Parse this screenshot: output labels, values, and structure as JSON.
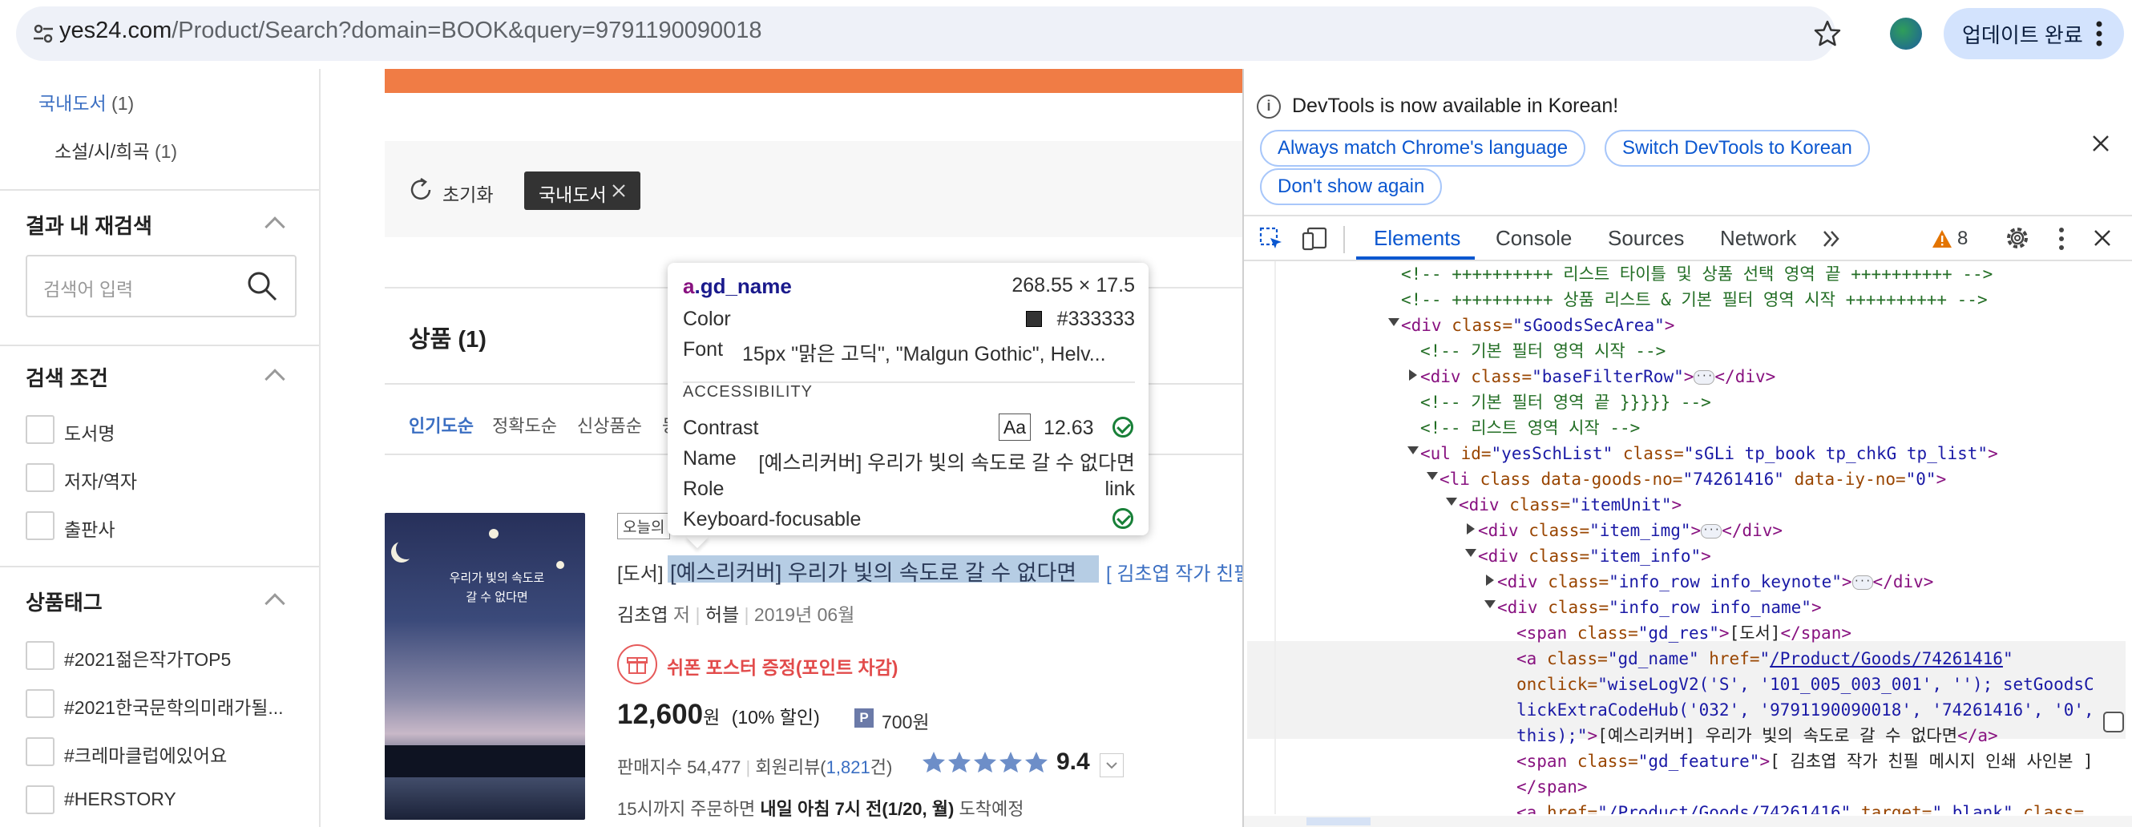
{
  "browser": {
    "url_host": "yes24.com",
    "url_path": "/Product/Search?domain=BOOK&query=9791190090018",
    "update_button": "업데이트 완료"
  },
  "sidebar": {
    "category": {
      "label": "국내도서",
      "count": "(1)"
    },
    "subcategory": {
      "label": "소설/시/희곡",
      "count": "(1)"
    },
    "research_title": "결과 내 재검색",
    "research_placeholder": "검색어 입력",
    "conditions_title": "검색 조건",
    "conditions": [
      "도서명",
      "저자/역자",
      "출판사"
    ],
    "tags_title": "상품태그",
    "tags": [
      "#2021젊은작가TOP5",
      "#2021한국문학의미래가될...",
      "#크레마클럽에있어요",
      "#HERSTORY"
    ]
  },
  "filter": {
    "reset_label": "초기화",
    "chip_label": "국내도서"
  },
  "results": {
    "title": "상품 (1)",
    "sort": [
      "인기도순",
      "정확도순",
      "신상품순",
      "등"
    ],
    "badge": "오늘의",
    "product": {
      "category": "[도서]",
      "title": "[예스리커버] 우리가 빛의 속도로 갈 수 없다면",
      "feature": "[ 김초엽 작가 친필",
      "author": "김초엽",
      "author_role": "저",
      "publisher": "허블",
      "date": "2019년 06월",
      "gift": "쉬폰 포스터 증정(포인트 차감)",
      "price": "12,600",
      "price_unit": "원",
      "discount": "(10% 할인)",
      "points": "700원",
      "sales_index": "판매지수 54,477",
      "review_label": "회원리뷰(",
      "review_count": "1,821",
      "review_suffix": "건)",
      "rating": "9.4",
      "stars": 5,
      "delivery_prefix": "15시까지 주문하면",
      "delivery_bold": "내일 아침 7시 전(1/20, 월)",
      "delivery_suffix": "도착예정",
      "cover_text": "우리가 빛의 속도로 갈 수 없다면"
    }
  },
  "tooltip": {
    "selector_tag": "a",
    "selector_class": ".gd_name",
    "size": "268.55 × 17.5",
    "color_label": "Color",
    "color_value": "#333333",
    "font_label": "Font",
    "font_value": "15px \"맑은 고딕\", \"Malgun Gothic\", Helv...",
    "accessibility_title": "ACCESSIBILITY",
    "contrast_label": "Contrast",
    "contrast_aa": "Aa",
    "contrast_value": "12.63",
    "name_label": "Name",
    "name_value": "[예스리커버] 우리가 빛의 속도로 갈 수 없다면",
    "role_label": "Role",
    "role_value": "link",
    "keyboard_label": "Keyboard-focusable"
  },
  "devtools": {
    "info_text": "DevTools is now available in Korean!",
    "btn_match": "Always match Chrome's language",
    "btn_switch": "Switch DevTools to Korean",
    "btn_dont": "Don't show again",
    "tabs": [
      "Elements",
      "Console",
      "Sources",
      "Network"
    ],
    "warning_count": "8"
  },
  "code": {
    "l1": "<!-- ++++++++++ 리스트 타이틀 및 상품 선택 영역 끝 ++++++++++ -->",
    "l2": "<!-- ++++++++++ 상품 리스트 & 기본 필터 영역 시작 ++++++++++ -->",
    "l3a": "<div",
    "l3b": "class=",
    "l3c": "\"sGoodsSecArea\"",
    "l4": "<!--  기본 필터 영역 시작  -->",
    "l5c": "\"baseFilterRow\"",
    "l6": "<!--  기본 필터 영역 끝 }}}}} -->",
    "l7": "<!--  리스트 영역 시작  -->",
    "l8a": "<ul",
    "l8b": "id=",
    "l8c": "\"yesSchList\"",
    "l8d": "\"sGLi tp_book tp_chkG tp_list\"",
    "l9a": "<li",
    "l9b": "class data-goods-no=",
    "l9c": "\"74261416\"",
    "l9d": "data-iy-no=",
    "l9e": "\"0\"",
    "l10c": "\"itemUnit\"",
    "l11c": "\"item_img\"",
    "l12c": "\"item_info\"",
    "l13c": "\"info_row info_keynote\"",
    "l14c": "\"info_row info_name\"",
    "l15a": "<span",
    "l15c": "\"gd_res\"",
    "l15t": "[도서]",
    "l16a": "<a",
    "l16c": "\"gd_name\"",
    "l16h": "href=",
    "l16l": "/Product/Goods/74261416",
    "l17a": "onclick=",
    "l17b": "\"wiseLogV2('S', '101_005_003_001', ''); setGoodsC",
    "l18": "lickExtraCodeHub('032', '9791190090018', '74261416', '0',",
    "l19a": "this);\"",
    "l19t": "[예스리커버] 우리가 빛의 속도로 갈 수 없다면",
    "l20c": "\"gd_feature\"",
    "l20t": "[ 김초엽 작가 친필 메시지 인쇄 사인본 ]",
    "l21": "</span>",
    "l22l": "/Product/Goods/74261416",
    "l22t": "target=",
    "l22v": "\"_blank\"",
    "l22e": "class="
  }
}
